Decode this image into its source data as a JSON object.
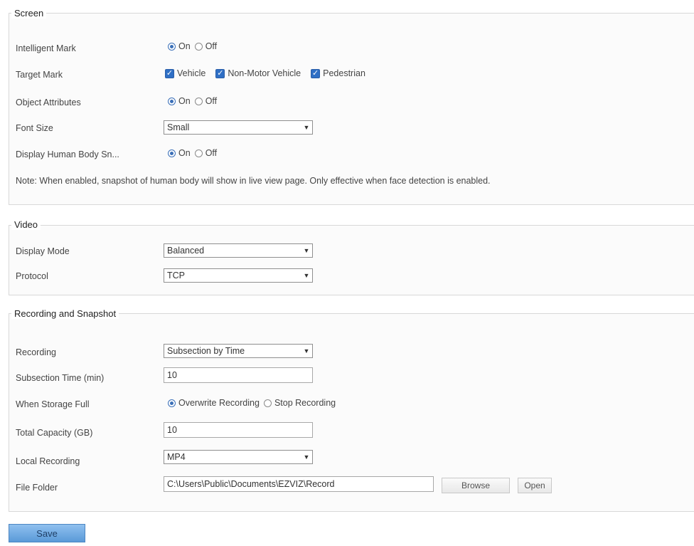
{
  "screen": {
    "legend": "Screen",
    "intelligent_mark": {
      "label": "Intelligent Mark",
      "on": "On",
      "off": "Off",
      "selected": "on"
    },
    "target_mark": {
      "label": "Target Mark",
      "options": [
        "Vehicle",
        "Non-Motor Vehicle",
        "Pedestrian"
      ]
    },
    "object_attributes": {
      "label": "Object Attributes",
      "on": "On",
      "off": "Off",
      "selected": "on"
    },
    "font_size": {
      "label": "Font Size",
      "value": "Small"
    },
    "display_human_body": {
      "label": "Display Human Body Sn...",
      "on": "On",
      "off": "Off",
      "selected": "on"
    },
    "note": "Note: When enabled, snapshot of human body will show in live view page. Only effective when face detection is enabled."
  },
  "video": {
    "legend": "Video",
    "display_mode": {
      "label": "Display Mode",
      "value": "Balanced"
    },
    "protocol": {
      "label": "Protocol",
      "value": "TCP"
    }
  },
  "recording": {
    "legend": "Recording and Snapshot",
    "recording": {
      "label": "Recording",
      "value": "Subsection by Time"
    },
    "subsection_time": {
      "label": "Subsection Time (min)",
      "value": "10"
    },
    "when_storage_full": {
      "label": "When Storage Full",
      "option1": "Overwrite Recording",
      "option2": "Stop Recording",
      "selected": "option1"
    },
    "total_capacity": {
      "label": "Total Capacity (GB)",
      "value": "10"
    },
    "local_recording": {
      "label": "Local Recording",
      "value": "MP4"
    },
    "file_folder": {
      "label": "File Folder",
      "value": "C:\\Users\\Public\\Documents\\EZVIZ\\Record",
      "browse": "Browse",
      "open": "Open"
    }
  },
  "actions": {
    "save": "Save"
  },
  "icons": {
    "checkmark": "checkmark-icon",
    "dropdown": "chevron-down-icon"
  },
  "colors": {
    "accent": "#2f6fc5",
    "save_button": "#6fa8df"
  }
}
